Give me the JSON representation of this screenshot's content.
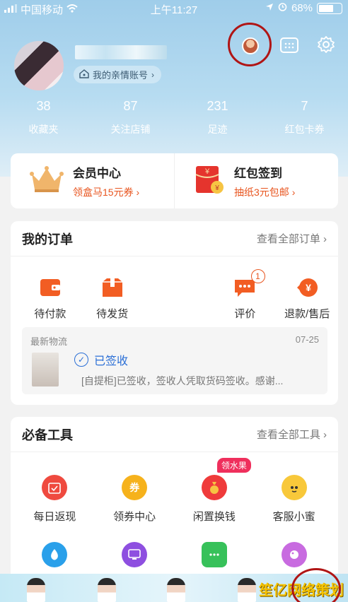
{
  "status_bar": {
    "carrier": "中国移动",
    "time": "上午11:27",
    "battery": "68%"
  },
  "profile": {
    "family_account_label": "我的亲情账号"
  },
  "stats": [
    {
      "value": "38",
      "label": "收藏夹"
    },
    {
      "value": "87",
      "label": "关注店铺"
    },
    {
      "value": "231",
      "label": "足迹"
    },
    {
      "value": "7",
      "label": "红包卡券"
    }
  ],
  "promo": {
    "vip": {
      "title": "会员中心",
      "subtitle": "领盒马15元券"
    },
    "redpacket": {
      "title": "红包签到",
      "subtitle": "抽纸3元包邮"
    }
  },
  "orders": {
    "title": "我的订单",
    "view_all": "查看全部订单",
    "items": [
      {
        "label": "待付款"
      },
      {
        "label": "待发货"
      },
      {
        "label": "评价",
        "badge": "1"
      },
      {
        "label": "退款/售后"
      }
    ],
    "logistics": {
      "header": "最新物流",
      "date": "07-25",
      "status": "已签收",
      "description": "[自提柜]已签收，签收人凭取货码签收。感谢..."
    }
  },
  "tools": {
    "title": "必备工具",
    "view_all": "查看全部工具",
    "items": [
      {
        "label": "每日返现"
      },
      {
        "label": "领券中心",
        "icon_text": "券"
      },
      {
        "label": "闲置换钱",
        "tag": "领水果"
      },
      {
        "label": "客服小蜜"
      }
    ]
  },
  "watermark": "笙亿网络策划",
  "colors": {
    "accent": "#e8551f",
    "link_blue": "#2b6fd6",
    "header_blue": "#9fcdea"
  }
}
